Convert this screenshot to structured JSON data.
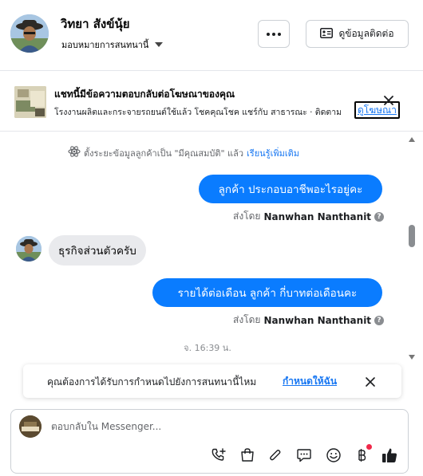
{
  "header": {
    "name": "วิทยา สังข์นุ้ย",
    "assign_label": "มอบหมายการสนทนานี้",
    "contact_button": "ดูข้อมูลติดต่อ"
  },
  "ad": {
    "title": "แชทนี้มีข้อความตอบกลับต่อโฆษณาของคุณ",
    "description": "โรงงานผลิตและกระจายรถยนต์ใช้แล้ว โชคคุณโชค แชร์กับ สาธารณะ · ติดตาม",
    "view_ad": "ดูโฆษณา"
  },
  "conversation": {
    "system_notice": "ตั้งระยะข้อมูลลูกค้าเป็น \"มีคุณสมบัติ\" แล้ว",
    "learn_more": "เรียนรู้เพิ่มเติม",
    "messages": [
      {
        "text": "ลูกค้า  ประกอบอาชีพอะไรอยู่คะ",
        "direction": "outgoing"
      },
      {
        "text": "ธุรกิจส่วนตัวครับ",
        "direction": "incoming"
      },
      {
        "text": "รายได้ต่อเดือน  ลูกค้า   กี่บาทต่อเดือนคะ",
        "direction": "outgoing"
      }
    ],
    "sent_by_prefix": "ส่งโดย",
    "sender": "Nanwhan Nanthanit",
    "timestamp": "จ. 16:39 น."
  },
  "followup": {
    "question": "คุณต้องการได้รับการกำหนดไปยังการสนทนานี้ไหม",
    "action": "กำหนดให้ฉัน"
  },
  "composer": {
    "placeholder": "ตอบกลับใน Messenger..."
  },
  "toolbar_icons": [
    "phone-add-icon",
    "shopping-bag-icon",
    "paperclip-icon",
    "chat-bubble-icon",
    "emoji-icon",
    "baht-icon",
    "thumbs-up-icon"
  ],
  "colors": {
    "accent": "#1877f2",
    "outgoing_bubble": "#0a7cff",
    "incoming_bubble": "#e9eaed",
    "notification": "#f02849"
  }
}
